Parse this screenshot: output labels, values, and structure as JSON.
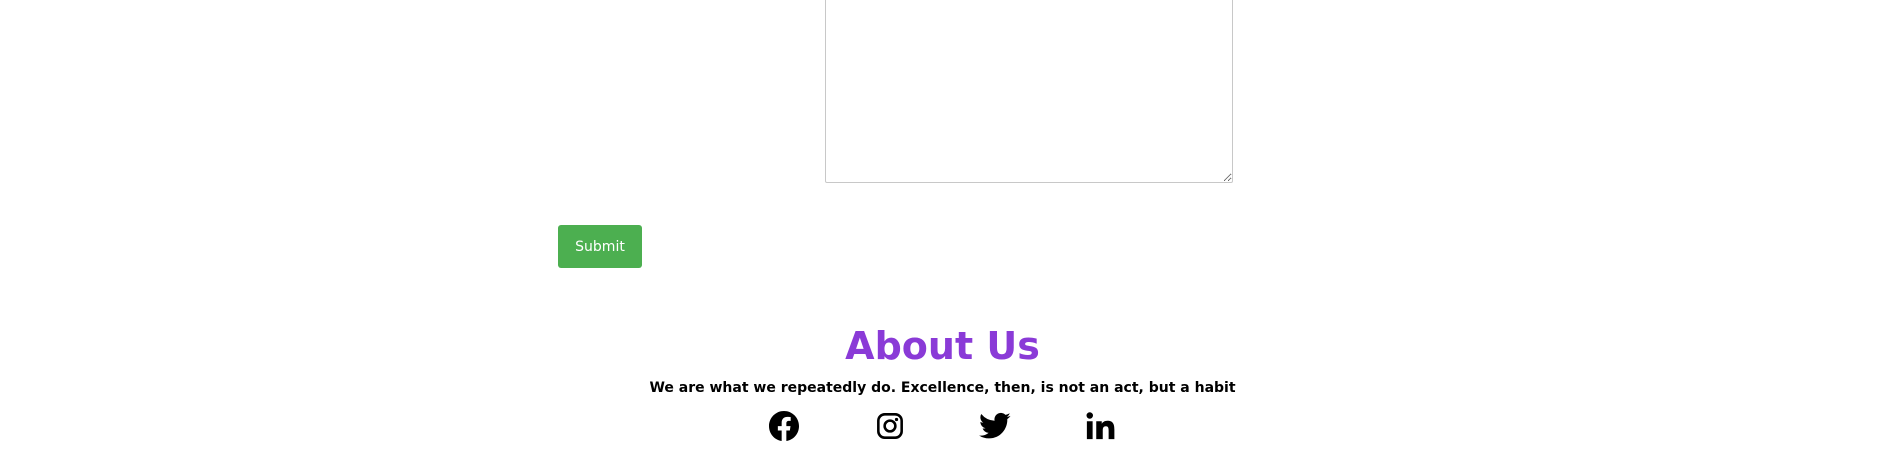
{
  "form": {
    "message_value": "",
    "submit_label": "Submit"
  },
  "about": {
    "title": "About Us",
    "quote": "We are what we repeatedly do. Excellence, then, is not an act, but a habit"
  },
  "social": [
    {
      "name": "facebook",
      "icon": "facebook-icon"
    },
    {
      "name": "instagram",
      "icon": "instagram-icon"
    },
    {
      "name": "twitter",
      "icon": "twitter-icon"
    },
    {
      "name": "linkedin",
      "icon": "linkedin-icon"
    }
  ],
  "colors": {
    "submit_bg": "#4caf50",
    "about_title": "#8a3ad7",
    "text": "#000000"
  }
}
